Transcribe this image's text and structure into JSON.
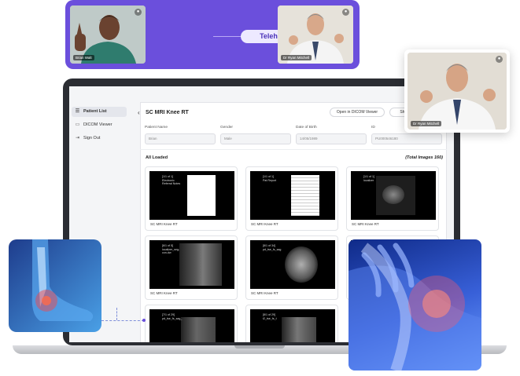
{
  "telehealth": {
    "label": "Telehealth",
    "left_tile": {
      "name_tag": "Brian Walt"
    },
    "right_tile": {
      "name_tag": "Dr Ryan Mitchell"
    }
  },
  "floating_video": {
    "name_tag": "Dr Ryan Mitchell"
  },
  "sidebar": {
    "items": [
      {
        "label": "Patient List",
        "active": true,
        "icon": "list-icon"
      },
      {
        "label": "DICOM Viewer",
        "active": false,
        "icon": "monitor-icon"
      },
      {
        "label": "Sign Out",
        "active": false,
        "icon": "sign-out-icon"
      }
    ]
  },
  "header": {
    "back_icon": "chevron-left-icon",
    "title": "SC MRI Knee RT",
    "open_button": "Open in DICOM Viewer",
    "share_button": "Share"
  },
  "patient_fields": [
    {
      "label": "Patient Name",
      "value": "Brian"
    },
    {
      "label": "Gender",
      "value": "Male"
    },
    {
      "label": "Date of Birth",
      "value": "14/05/1989"
    },
    {
      "label": "ID",
      "value": "PU000546180"
    }
  ],
  "images": {
    "status": "All Loaded",
    "total": "(Total Images 160)",
    "cards": [
      {
        "label": "SC MRI Knee RT",
        "meta": "[1/1 of 1]\nElectronic\nReferral Notes"
      },
      {
        "label": "SC MRI Knee RT",
        "meta": "[1/1 of 1]\nPat Report"
      },
      {
        "label": "SC MRI Knee RT",
        "meta": "[1/1 of 1]\nlocalizer"
      },
      {
        "label": "SC MRI Knee RT",
        "meta": "[6/1 of 5]\nlocalizer_seg-\ncon-dw"
      },
      {
        "label": "SC MRI Knee RT",
        "meta": "[8/1 of 34]\npd_tse_fs_sag"
      },
      {
        "label": "",
        "meta": ""
      },
      {
        "label": "",
        "meta": "[7/1 of 29]\npd_tse_fs_sag_"
      },
      {
        "label": "",
        "meta": "[8/1 of 29]\nt2_tse_fs_t"
      }
    ]
  },
  "colors": {
    "brand": "#6b4fdc",
    "telehealth_pill": "#ede9ff"
  }
}
